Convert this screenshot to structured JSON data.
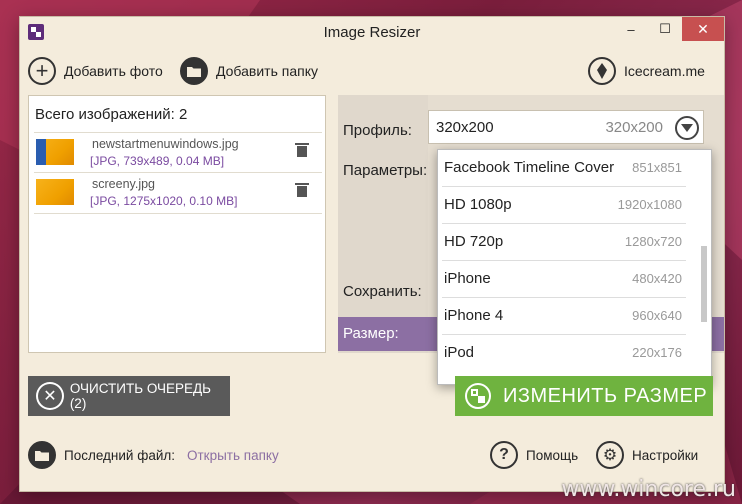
{
  "window": {
    "title": "Image Resizer",
    "controls": {
      "minimize": "–",
      "maximize": "☐",
      "close": "✕"
    }
  },
  "toolbar": {
    "add_photo": "Добавить фото",
    "add_folder": "Добавить папку",
    "site": "Icecream.me"
  },
  "queue": {
    "count_label": "Всего изображений: 2",
    "files": [
      {
        "name": "newstartmenuwindows.jpg",
        "meta": "[JPG, 739x489, 0.04 MB]"
      },
      {
        "name": "screeny.jpg",
        "meta": "[JPG, 1275x1020, 0.10 MB]"
      }
    ]
  },
  "settings": {
    "profile_label": "Профиль:",
    "params_label": "Параметры:",
    "save_label": "Сохранить:",
    "size_label": "Размер:",
    "selected_profile": {
      "name": "320x200",
      "dims": "320x200"
    }
  },
  "dropdown": {
    "items": [
      {
        "name": "Facebook Timeline Cover",
        "dims": "851x851"
      },
      {
        "name": "HD 1080p",
        "dims": "1920x1080"
      },
      {
        "name": "HD 720p",
        "dims": "1280x720"
      },
      {
        "name": "iPhone",
        "dims": "480x420"
      },
      {
        "name": "iPhone 4",
        "dims": "960x640"
      },
      {
        "name": "iPod",
        "dims": "220x176"
      }
    ]
  },
  "actions": {
    "clear_queue": "ОЧИСТИТЬ ОЧЕРЕДЬ (2)",
    "resize": "ИЗМЕНИТЬ РАЗМЕР"
  },
  "footer": {
    "last_file_label": "Последний файл:",
    "open_folder": "Открыть папку",
    "help": "Помощь",
    "settings": "Настройки"
  },
  "watermark": "www.wincore.ru",
  "colors": {
    "accent_purple": "#8c6fa3",
    "resize_green": "#6fb33f",
    "clear_gray": "#5a5a5a",
    "window_bg": "#f4ecdc"
  }
}
